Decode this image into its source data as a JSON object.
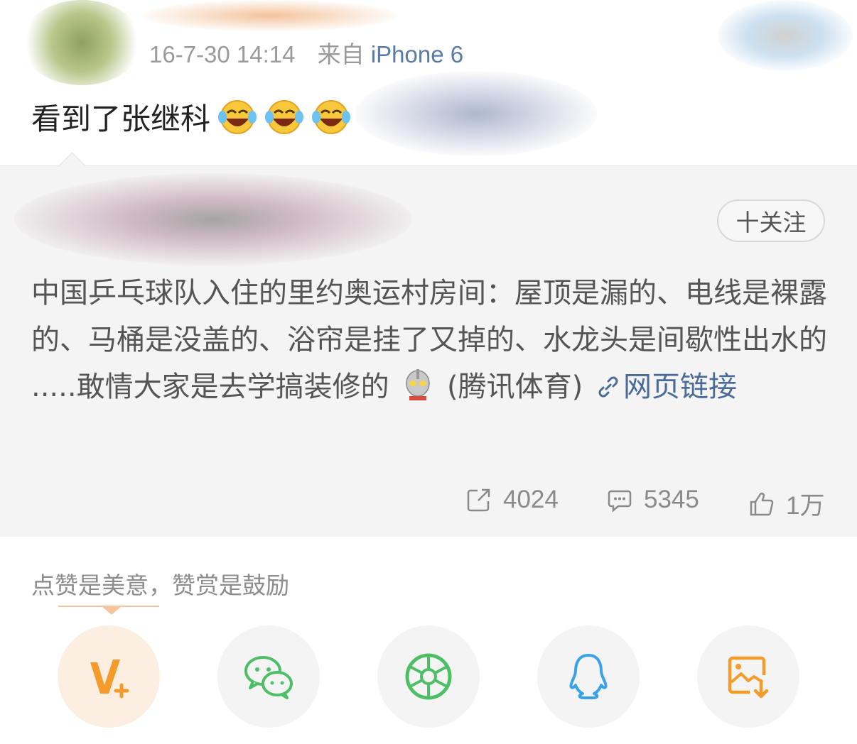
{
  "post": {
    "time": "16-7-30 14:14",
    "source_prefix": "来自",
    "device": "iPhone 6",
    "text": "看到了张继科",
    "emojis": [
      "laugh-cry-emoji",
      "laugh-cry-emoji",
      "laugh-cry-emoji"
    ]
  },
  "repost": {
    "follow_label": "十关注",
    "body_part1": "中国乒乓球队入住的里约奥运村房间：屋顶是漏的、电线是裸露的、马桶是没盖的、浴帘是挂了又掉的、水龙头是间歇性出水的 .....敢情大家是去学搞装修的",
    "body_part2": "(腾讯体育)",
    "link_text": "网页链接",
    "stats": {
      "reposts": "4024",
      "comments": "5345",
      "likes": "1万"
    }
  },
  "reward": {
    "title": "点赞是美意，赞赏是鼓励",
    "buttons": [
      "v-plus-icon",
      "wechat-icon",
      "moments-icon",
      "qq-icon",
      "save-image-icon"
    ]
  },
  "colors": {
    "link": "#4a6b9a",
    "accent_orange": "#f59b2c",
    "wechat_green": "#4fbf67",
    "qq_blue": "#3aa2e8"
  }
}
